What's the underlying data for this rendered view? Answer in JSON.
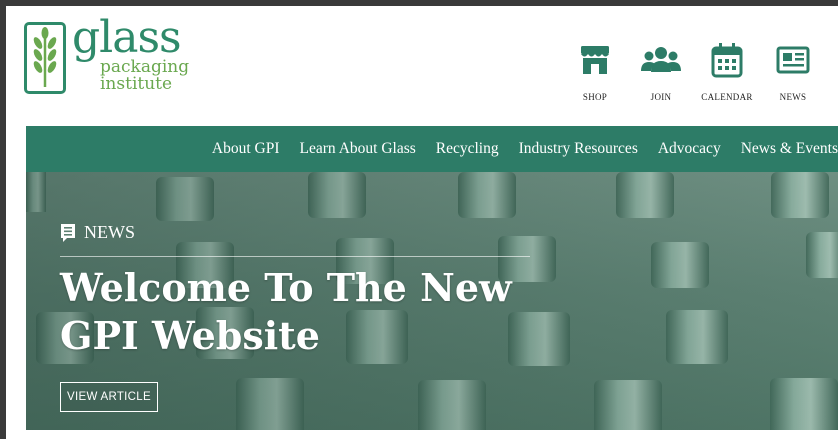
{
  "brand": {
    "word1": "glass",
    "word2": "packaging",
    "word3": "institute",
    "primary_color": "#2f8a6a",
    "secondary_color": "#6aa84f"
  },
  "utility_nav": [
    {
      "label": "SHOP",
      "icon": "storefront-icon"
    },
    {
      "label": "JOIN",
      "icon": "people-icon"
    },
    {
      "label": "CALENDAR",
      "icon": "calendar-icon"
    },
    {
      "label": "NEWS",
      "icon": "newspaper-icon"
    }
  ],
  "main_nav": {
    "background_color": "#2d7c67",
    "items": [
      "About GPI",
      "Learn About Glass",
      "Recycling",
      "Industry Resources",
      "Advocacy",
      "News & Events"
    ]
  },
  "hero": {
    "tag_label": "NEWS",
    "tag_icon": "news-tag-icon",
    "headline": "Welcome To The New GPI Website",
    "button_label": "VIEW ARTICLE"
  }
}
